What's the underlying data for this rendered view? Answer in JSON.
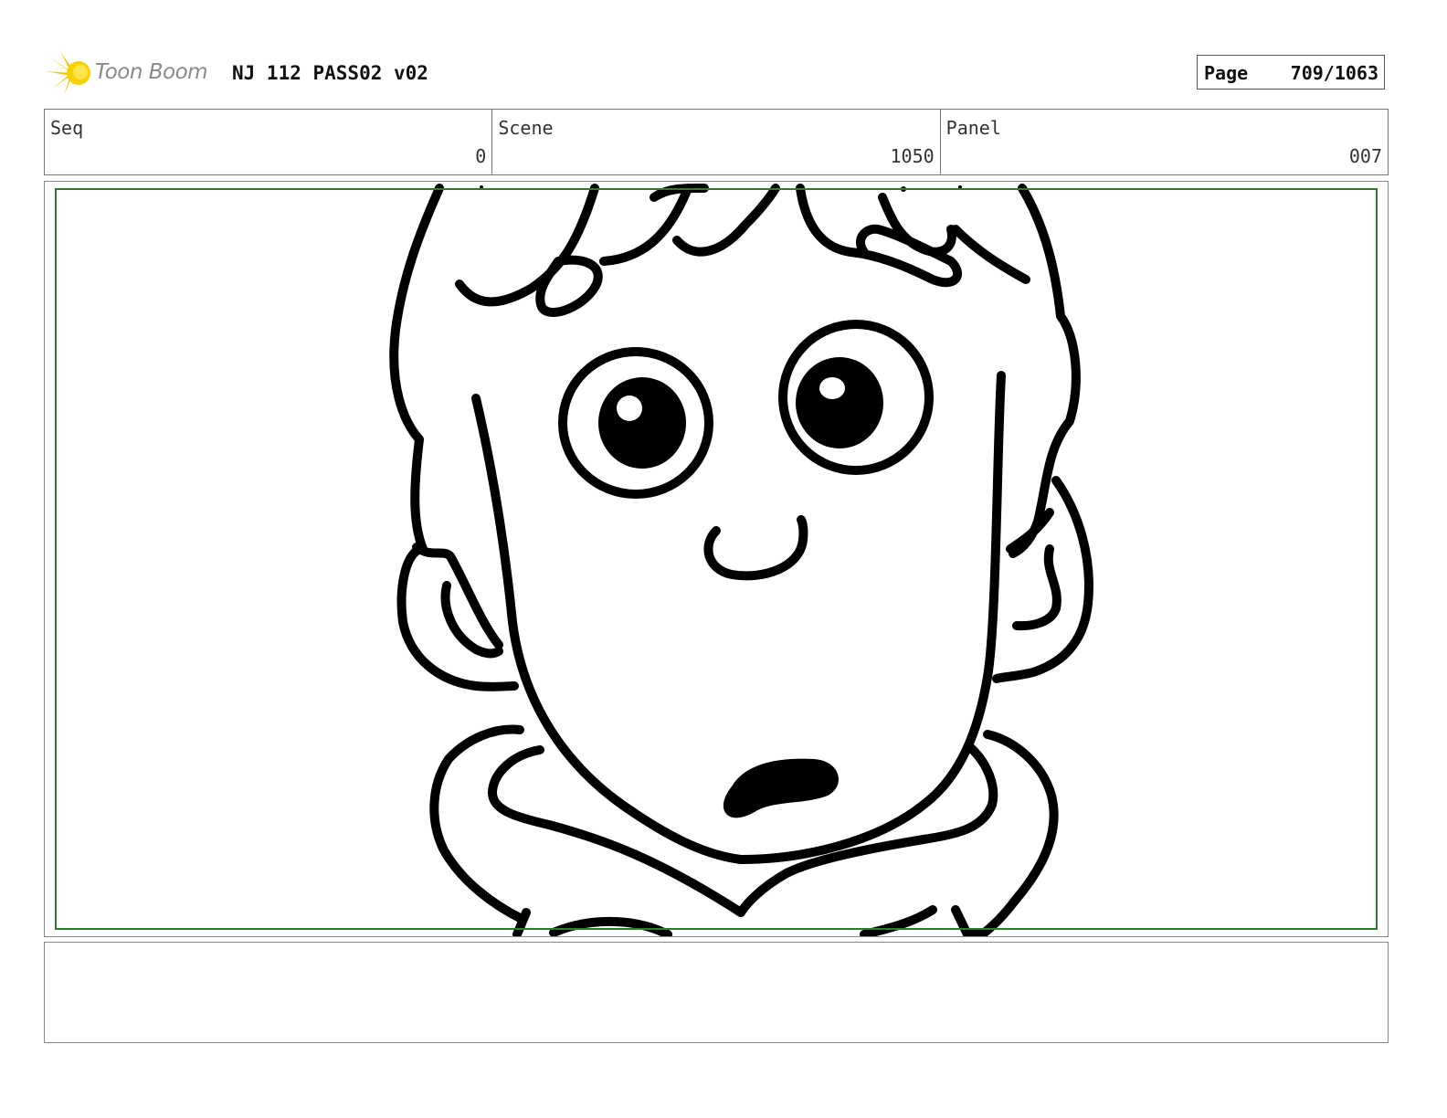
{
  "header": {
    "logo_text": "Toon Boom",
    "title": "NJ 112 PASS02 v02",
    "page_label": "Page",
    "page_value": "709/1063"
  },
  "info": {
    "seq_label": "Seq",
    "seq_value": "0",
    "scene_label": "Scene",
    "scene_value": "1050",
    "panel_label": "Panel",
    "panel_value": "007"
  },
  "panel": {
    "frame_color": "#2f7a2f",
    "drawing": "line-art character face"
  },
  "notes": {
    "text": ""
  }
}
